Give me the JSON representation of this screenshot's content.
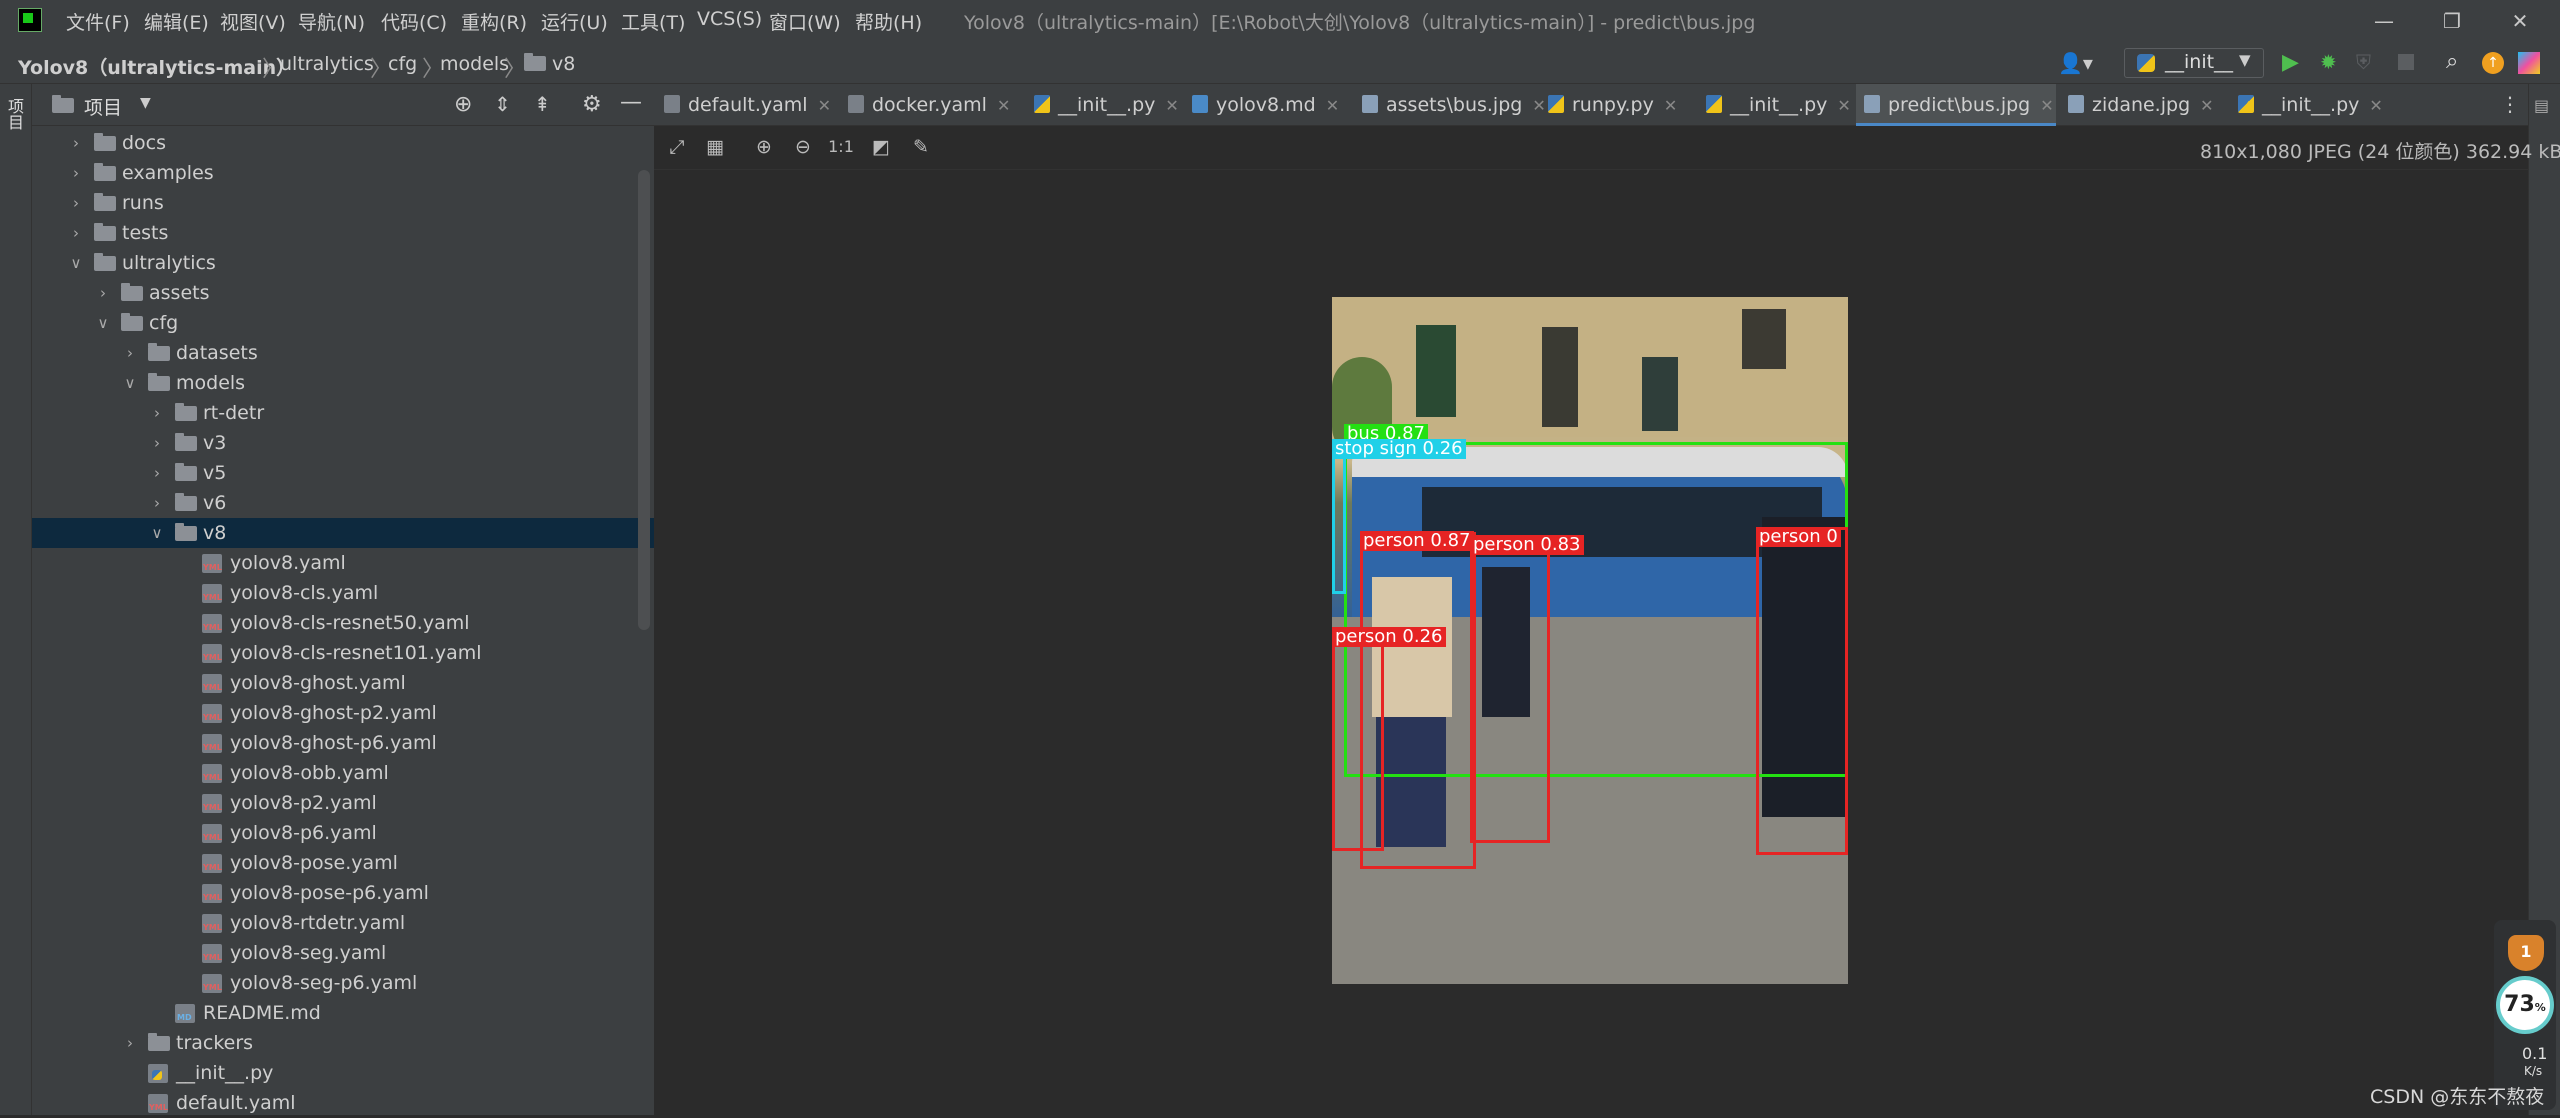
{
  "menu": [
    "文件(F)",
    "编辑(E)",
    "视图(V)",
    "导航(N)",
    "代码(C)",
    "重构(R)",
    "运行(U)",
    "工具(T)",
    "VCS(S)",
    "窗口(W)",
    "帮助(H)"
  ],
  "window_title": "Yolov8（ultralytics-main）[E:\\Robot\\大创\\Yolov8（ultralytics-main）] - predict\\bus.jpg",
  "breadcrumb": [
    "Yolov8（ultralytics-main）",
    "ultralytics",
    "cfg",
    "models",
    "v8"
  ],
  "run_config": "__init__",
  "left_strip_label": "项目",
  "project_panel": {
    "title": "项目"
  },
  "tree": [
    {
      "label": "docs",
      "kind": "folder",
      "expanded": false
    },
    {
      "label": "examples",
      "kind": "folder",
      "expanded": false
    },
    {
      "label": "runs",
      "kind": "folder",
      "expanded": false
    },
    {
      "label": "tests",
      "kind": "folder",
      "expanded": false
    },
    {
      "label": "ultralytics",
      "kind": "folder",
      "expanded": true
    },
    {
      "label": "assets",
      "kind": "folder",
      "expanded": false
    },
    {
      "label": "cfg",
      "kind": "folder",
      "expanded": true
    },
    {
      "label": "datasets",
      "kind": "folder",
      "expanded": false
    },
    {
      "label": "models",
      "kind": "folder",
      "expanded": true
    },
    {
      "label": "rt-detr",
      "kind": "folder",
      "expanded": false
    },
    {
      "label": "v3",
      "kind": "folder",
      "expanded": false
    },
    {
      "label": "v5",
      "kind": "folder",
      "expanded": false
    },
    {
      "label": "v6",
      "kind": "folder",
      "expanded": false
    },
    {
      "label": "v8",
      "kind": "folder",
      "expanded": true,
      "selected": true
    },
    {
      "label": "yolov8.yaml",
      "kind": "yml"
    },
    {
      "label": "yolov8-cls.yaml",
      "kind": "yml"
    },
    {
      "label": "yolov8-cls-resnet50.yaml",
      "kind": "yml"
    },
    {
      "label": "yolov8-cls-resnet101.yaml",
      "kind": "yml"
    },
    {
      "label": "yolov8-ghost.yaml",
      "kind": "yml"
    },
    {
      "label": "yolov8-ghost-p2.yaml",
      "kind": "yml"
    },
    {
      "label": "yolov8-ghost-p6.yaml",
      "kind": "yml"
    },
    {
      "label": "yolov8-obb.yaml",
      "kind": "yml"
    },
    {
      "label": "yolov8-p2.yaml",
      "kind": "yml"
    },
    {
      "label": "yolov8-p6.yaml",
      "kind": "yml"
    },
    {
      "label": "yolov8-pose.yaml",
      "kind": "yml"
    },
    {
      "label": "yolov8-pose-p6.yaml",
      "kind": "yml"
    },
    {
      "label": "yolov8-rtdetr.yaml",
      "kind": "yml"
    },
    {
      "label": "yolov8-seg.yaml",
      "kind": "yml"
    },
    {
      "label": "yolov8-seg-p6.yaml",
      "kind": "yml"
    },
    {
      "label": "README.md",
      "kind": "md"
    },
    {
      "label": "trackers",
      "kind": "folder",
      "expanded": false
    },
    {
      "label": "__init__.py",
      "kind": "py"
    },
    {
      "label": "default.yaml",
      "kind": "yml"
    }
  ],
  "tabs": [
    {
      "label": "default.yaml",
      "icon": "yaml-file-icon"
    },
    {
      "label": "docker.yaml",
      "icon": "yaml-file-icon"
    },
    {
      "label": "__init__.py",
      "icon": "python-file-icon"
    },
    {
      "label": "yolov8.md",
      "icon": "markdown-file-icon"
    },
    {
      "label": "assets\\bus.jpg",
      "icon": "image-file-icon"
    },
    {
      "label": "runpy.py",
      "icon": "python-file-icon"
    },
    {
      "label": "__init__.py",
      "icon": "python-file-icon"
    },
    {
      "label": "predict\\bus.jpg",
      "icon": "image-file-icon",
      "active": true
    },
    {
      "label": "zidane.jpg",
      "icon": "image-file-icon"
    },
    {
      "label": "__init__.py",
      "icon": "python-file-icon"
    }
  ],
  "image_toolbar": {
    "actual_size_label": "1:1",
    "info": "810x1,080 JPEG (24 位颜色) 362.94 kB"
  },
  "detections": [
    {
      "label": "bus 0.87",
      "color": "#24e012"
    },
    {
      "label": "stop sign 0.26",
      "color": "#20d0e8"
    },
    {
      "label": "person 0.87",
      "color": "#e62424"
    },
    {
      "label": "person 0.83",
      "color": "#e62424"
    },
    {
      "label": "person 0.26",
      "color": "#e62424"
    },
    {
      "label": "person 0",
      "color": "#e62424"
    }
  ],
  "widget": {
    "shield": "1",
    "percent": "73",
    "percent_unit": "%",
    "net_value": "0.1",
    "net_unit": "K/s"
  },
  "watermark": "CSDN @东东不熬夜"
}
